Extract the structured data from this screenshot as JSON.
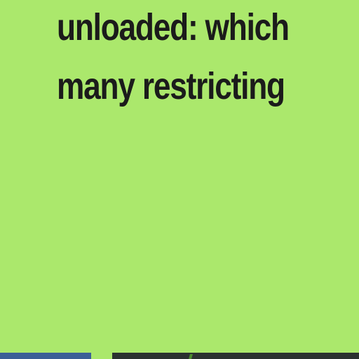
{
  "article": {
    "heading_lines": [
      "unloaded: which",
      "many restricting"
    ]
  },
  "thumbnails": [
    {
      "name": "blue-thumbnail",
      "color": "#3c5f97"
    },
    {
      "name": "dark-photo-thumbnail",
      "color": "#2b3130"
    }
  ],
  "colors": {
    "background": "#abe86c",
    "heading_text": "#1b1b1b"
  }
}
